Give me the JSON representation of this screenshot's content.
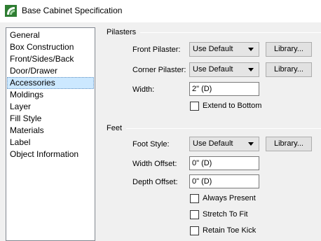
{
  "window": {
    "title": "Base Cabinet Specification",
    "icon": "chief-architect-app-icon"
  },
  "sidebar": {
    "items": [
      {
        "label": "General",
        "selected": false
      },
      {
        "label": "Box Construction",
        "selected": false
      },
      {
        "label": "Front/Sides/Back",
        "selected": false
      },
      {
        "label": "Door/Drawer",
        "selected": false
      },
      {
        "label": "Accessories",
        "selected": true
      },
      {
        "label": "Moldings",
        "selected": false
      },
      {
        "label": "Layer",
        "selected": false
      },
      {
        "label": "Fill Style",
        "selected": false
      },
      {
        "label": "Materials",
        "selected": false
      },
      {
        "label": "Label",
        "selected": false
      },
      {
        "label": "Object Information",
        "selected": false
      }
    ]
  },
  "pilasters": {
    "group_label": "Pilasters",
    "front_label": "Front Pilaster:",
    "front_value": "Use Default",
    "front_library": "Library...",
    "corner_label": "Corner Pilaster:",
    "corner_value": "Use Default",
    "corner_library": "Library...",
    "width_label": "Width:",
    "width_value": "2\" (D)",
    "extend_label": "Extend to Bottom",
    "extend_checked": false
  },
  "feet": {
    "group_label": "Feet",
    "style_label": "Foot Style:",
    "style_value": "Use Default",
    "style_library": "Library...",
    "width_offset_label": "Width Offset:",
    "width_offset_value": "0\" (D)",
    "depth_offset_label": "Depth Offset:",
    "depth_offset_value": "0\" (D)",
    "always_present_label": "Always Present",
    "stretch_label": "Stretch To Fit",
    "retain_label": "Retain Toe Kick"
  }
}
